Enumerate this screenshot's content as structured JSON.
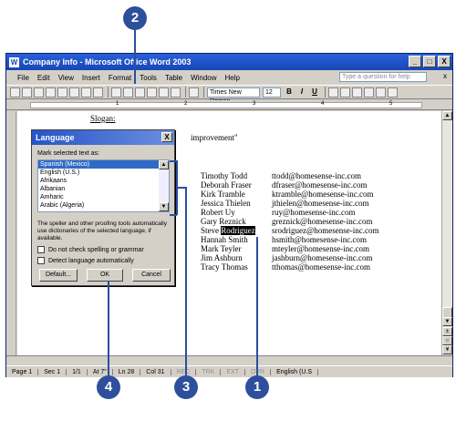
{
  "window": {
    "title": "Company Info - Microsoft Office Word 2003",
    "min": "_",
    "max": "□",
    "close": "X"
  },
  "menu": {
    "items": [
      "File",
      "Edit",
      "View",
      "Insert",
      "Format",
      "Tools",
      "Table",
      "Window",
      "Help"
    ],
    "help_placeholder": "Type a question for help",
    "close": "x"
  },
  "toolbar": {
    "font": "Times New Roman",
    "size": "12",
    "bold": "B",
    "italic": "I",
    "underline": "U"
  },
  "ruler": {
    "numbers": [
      "1",
      "2",
      "3",
      "4",
      "5"
    ]
  },
  "document": {
    "slogan": "Slogan:",
    "quote": "improvement\"",
    "people": [
      {
        "name": "Timothy Todd",
        "email": "ttodd@homesense-inc.com"
      },
      {
        "name": "Deborah Fraser",
        "email": "dfraser@homesense-inc.com"
      },
      {
        "name": "Kirk Tramble",
        "email": "ktramble@homesense-inc.com"
      },
      {
        "name": "Jessica Thielen",
        "email": "jthielen@homesense-inc.com"
      },
      {
        "name": "Robert Uy",
        "email": "ruy@homesense-inc.com"
      },
      {
        "name": "Gary Reznick",
        "email": "greznick@homesense-inc.com"
      },
      {
        "name_pre": "Steve ",
        "name_sel": "Rodriguez",
        "email": "srodriguez@homesense-inc.com"
      },
      {
        "name": "Hannah Smith",
        "email": "hsmith@homesense-inc.com"
      },
      {
        "name": "Mark Teyler",
        "email": "mteyler@homesense-inc.com"
      },
      {
        "name": "Jim Ashburn",
        "email": "jashburn@homesense-inc.com"
      },
      {
        "name": "Tracy Thomas",
        "email": "tthomas@homesense-inc.com"
      }
    ]
  },
  "dialog": {
    "title": "Language",
    "close": "X",
    "mark_label": "Mark selected text as:",
    "languages": [
      "Spanish (Mexico)",
      "English (U.S.)",
      "Afrikaans",
      "Albanian",
      "Amharic",
      "Arabic (Algeria)"
    ],
    "description": "The speller and other proofing tools automatically use dictionaries of the selected language, if available.",
    "check1": "Do not check spelling or grammar",
    "check2": "Detect language automatically",
    "default_btn": "Default...",
    "ok_btn": "OK",
    "cancel_btn": "Cancel"
  },
  "status": {
    "page": "Page 1",
    "sec": "Sec 1",
    "pages": "1/1",
    "at": "At 7\"",
    "ln": "Ln 28",
    "col": "Col 31",
    "rec": "REC",
    "trk": "TRK",
    "ext": "EXT",
    "ovr": "OVR",
    "lang": "English (U.S"
  },
  "callouts": {
    "c1": "1",
    "c2": "2",
    "c3": "3",
    "c4": "4"
  },
  "colors": {
    "callout": "#2e4f9c",
    "title_bar": "#1747b5",
    "selection": "#316ac5"
  }
}
